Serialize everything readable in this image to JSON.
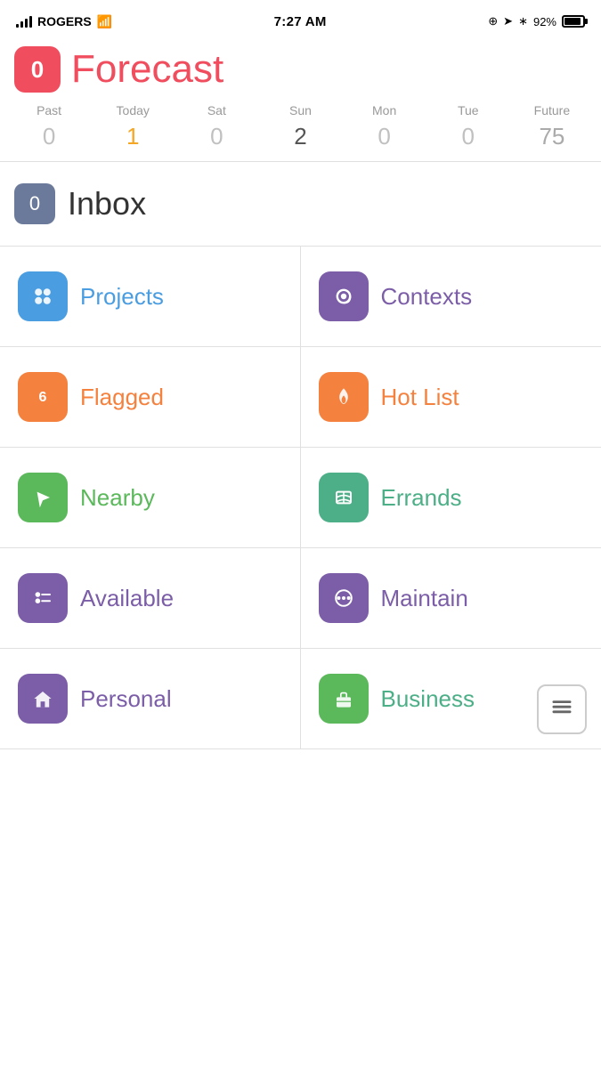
{
  "statusBar": {
    "carrier": "ROGERS",
    "time": "7:27 AM",
    "battery": "92%"
  },
  "forecast": {
    "badge": "0",
    "title": "Forecast",
    "calendar": [
      {
        "label": "Past",
        "count": "0",
        "type": "normal"
      },
      {
        "label": "Today",
        "count": "1",
        "type": "today"
      },
      {
        "label": "Sat",
        "count": "0",
        "type": "normal"
      },
      {
        "label": "Sun",
        "count": "2",
        "type": "has-items"
      },
      {
        "label": "Mon",
        "count": "0",
        "type": "normal"
      },
      {
        "label": "Tue",
        "count": "0",
        "type": "normal"
      },
      {
        "label": "Future",
        "count": "75",
        "type": "future"
      }
    ]
  },
  "inbox": {
    "badge": "0",
    "label": "Inbox"
  },
  "gridItems": [
    {
      "id": "projects",
      "label": "Projects",
      "labelColor": "label-blue",
      "iconColor": "icon-blue",
      "icon": "dots"
    },
    {
      "id": "contexts",
      "label": "Contexts",
      "labelColor": "label-purple",
      "iconColor": "icon-purple",
      "icon": "at"
    },
    {
      "id": "flagged",
      "label": "Flagged",
      "labelColor": "label-orange",
      "iconColor": "icon-orange",
      "icon": "flag-number",
      "badge": "6"
    },
    {
      "id": "hotlist",
      "label": "Hot List",
      "labelColor": "label-orange",
      "iconColor": "icon-orange2",
      "icon": "flame"
    },
    {
      "id": "nearby",
      "label": "Nearby",
      "labelColor": "label-green",
      "iconColor": "icon-green",
      "icon": "location"
    },
    {
      "id": "errands",
      "label": "Errands",
      "labelColor": "label-teal",
      "iconColor": "icon-teal",
      "icon": "map"
    },
    {
      "id": "available",
      "label": "Available",
      "labelColor": "label-purple",
      "iconColor": "icon-purple2",
      "icon": "list"
    },
    {
      "id": "maintain",
      "label": "Maintain",
      "labelColor": "label-purple",
      "iconColor": "icon-purple3",
      "icon": "dots-circle"
    },
    {
      "id": "personal",
      "label": "Personal",
      "labelColor": "label-purple",
      "iconColor": "icon-house",
      "icon": "house"
    },
    {
      "id": "business",
      "label": "Business",
      "labelColor": "label-teal",
      "iconColor": "icon-briefcase",
      "icon": "briefcase"
    }
  ],
  "addButton": {
    "label": "+"
  }
}
